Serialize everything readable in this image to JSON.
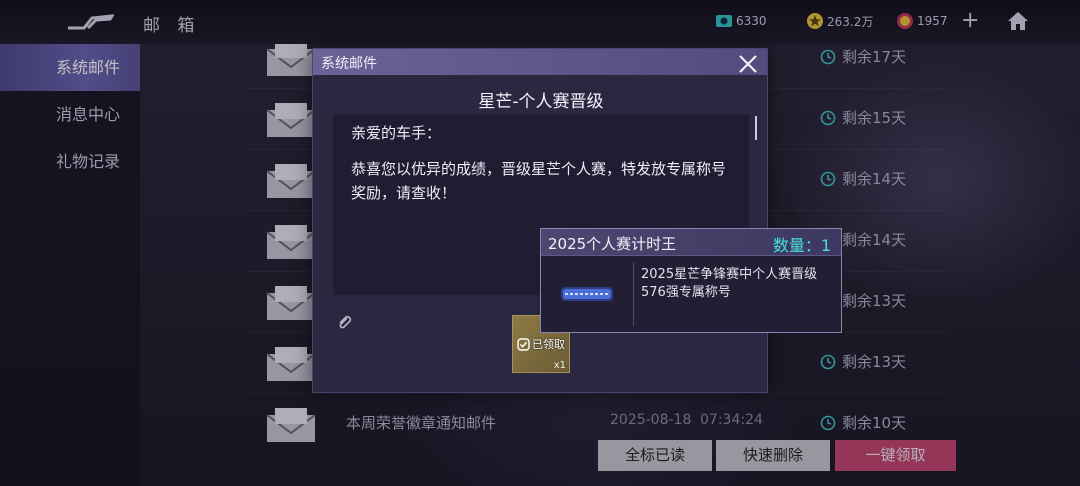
{
  "header": {
    "title": "邮 箱",
    "resources": [
      {
        "name": "camera-coin",
        "value": "6330",
        "color": "#35c4c4"
      },
      {
        "name": "star-coin",
        "value": "263.2万",
        "color": "#e8c53a"
      },
      {
        "name": "badge-coin",
        "value": "1957",
        "color": "#c9355f"
      }
    ],
    "plus": "+"
  },
  "sidebar": {
    "items": [
      {
        "label": "系统邮件",
        "active": true
      },
      {
        "label": "消息中心",
        "active": false
      },
      {
        "label": "礼物记录",
        "active": false
      }
    ]
  },
  "mails": [
    {
      "subject": "",
      "date": "",
      "time": "",
      "remain": "剩余17天"
    },
    {
      "subject": "",
      "date": "",
      "time": "",
      "remain": "剩余15天"
    },
    {
      "subject": "",
      "date": "",
      "time": "",
      "remain": "剩余14天"
    },
    {
      "subject": "",
      "date": "",
      "time": "",
      "remain": "剩余14天"
    },
    {
      "subject": "",
      "date": "",
      "time": "",
      "remain": "剩余13天"
    },
    {
      "subject": "",
      "date": "",
      "time": "",
      "remain": "剩余13天"
    },
    {
      "subject": "本周荣誉徽章通知邮件",
      "date": "2025-08-18",
      "time": "07:34:24",
      "remain": "剩余10天"
    }
  ],
  "buttons": {
    "mark_read": "全标已读",
    "quick_delete": "快速删除",
    "claim_all": "一键领取"
  },
  "dialog": {
    "header": "系统邮件",
    "title": "星芒-个人赛晋级",
    "greeting": "亲爱的车手：",
    "body": "恭喜您以优异的成绩，晋级星芒个人赛，特发放专属称号奖励，请查收！",
    "reward": {
      "status": "已领取",
      "qty": "x1"
    }
  },
  "tooltip": {
    "name": "2025个人赛计时王",
    "qty_label": "数量：1",
    "desc": "2025星芒争锋赛中个人赛晋级576强专属称号"
  },
  "colors": {
    "accent": "#6a63b0",
    "claim_button": "#c2466e",
    "qty_text": "#47e0df"
  }
}
